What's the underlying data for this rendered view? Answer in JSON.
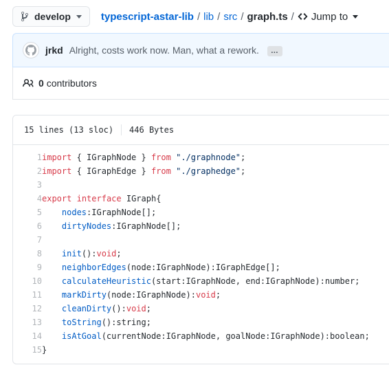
{
  "topbar": {
    "branch": {
      "label": "develop",
      "icon": "git-branch-icon"
    },
    "breadcrumb": {
      "repo": "typescript-astar-lib",
      "separator": "/",
      "segments": [
        "lib",
        "src"
      ],
      "file": "graph.ts"
    },
    "jump_to": {
      "label": "Jump to",
      "icon": "code-icon"
    }
  },
  "commit": {
    "author": "jrkd",
    "message": "Alright, costs work now. Man, what a rework.",
    "expand_label": "…",
    "avatar_icon": "github-mark-avatar",
    "background": "#f1f8ff",
    "border": "#c8e1ff"
  },
  "contributors": {
    "icon": "people-icon",
    "count": "0",
    "label": "contributors"
  },
  "file": {
    "lines_text": "15 lines (13 sloc)",
    "size_text": "446 Bytes",
    "code": [
      {
        "n": "1",
        "tokens": [
          {
            "t": "import",
            "c": "k"
          },
          {
            "t": " { IGraphNode } ",
            "c": "p"
          },
          {
            "t": "from",
            "c": "k"
          },
          {
            "t": " ",
            "c": "p"
          },
          {
            "t": "\"./graphnode\"",
            "c": "s"
          },
          {
            "t": ";",
            "c": "p"
          }
        ]
      },
      {
        "n": "2",
        "tokens": [
          {
            "t": "import",
            "c": "k"
          },
          {
            "t": " { IGraphEdge } ",
            "c": "p"
          },
          {
            "t": "from",
            "c": "k"
          },
          {
            "t": " ",
            "c": "p"
          },
          {
            "t": "\"./graphedge\"",
            "c": "s"
          },
          {
            "t": ";",
            "c": "p"
          }
        ]
      },
      {
        "n": "3",
        "tokens": []
      },
      {
        "n": "4",
        "tokens": [
          {
            "t": "export",
            "c": "k"
          },
          {
            "t": " ",
            "c": "p"
          },
          {
            "t": "interface",
            "c": "k"
          },
          {
            "t": " IGraph{",
            "c": "p"
          }
        ]
      },
      {
        "n": "5",
        "tokens": [
          {
            "t": "    ",
            "c": "p"
          },
          {
            "t": "nodes",
            "c": "f"
          },
          {
            "t": ":IGraphNode[];",
            "c": "p"
          }
        ]
      },
      {
        "n": "6",
        "tokens": [
          {
            "t": "    ",
            "c": "p"
          },
          {
            "t": "dirtyNodes",
            "c": "f"
          },
          {
            "t": ":IGraphNode[];",
            "c": "p"
          }
        ]
      },
      {
        "n": "7",
        "tokens": []
      },
      {
        "n": "8",
        "tokens": [
          {
            "t": "    ",
            "c": "p"
          },
          {
            "t": "init",
            "c": "f"
          },
          {
            "t": "():",
            "c": "p"
          },
          {
            "t": "void",
            "c": "k"
          },
          {
            "t": ";",
            "c": "p"
          }
        ]
      },
      {
        "n": "9",
        "tokens": [
          {
            "t": "    ",
            "c": "p"
          },
          {
            "t": "neighborEdges",
            "c": "f"
          },
          {
            "t": "(node:IGraphNode):IGraphEdge[];",
            "c": "p"
          }
        ]
      },
      {
        "n": "10",
        "tokens": [
          {
            "t": "    ",
            "c": "p"
          },
          {
            "t": "calculateHeuristic",
            "c": "f"
          },
          {
            "t": "(start:IGraphNode, end:IGraphNode):number;",
            "c": "p"
          }
        ]
      },
      {
        "n": "11",
        "tokens": [
          {
            "t": "    ",
            "c": "p"
          },
          {
            "t": "markDirty",
            "c": "f"
          },
          {
            "t": "(node:IGraphNode):",
            "c": "p"
          },
          {
            "t": "void",
            "c": "k"
          },
          {
            "t": ";",
            "c": "p"
          }
        ]
      },
      {
        "n": "12",
        "tokens": [
          {
            "t": "    ",
            "c": "p"
          },
          {
            "t": "cleanDirty",
            "c": "f"
          },
          {
            "t": "():",
            "c": "p"
          },
          {
            "t": "void",
            "c": "k"
          },
          {
            "t": ";",
            "c": "p"
          }
        ]
      },
      {
        "n": "13",
        "tokens": [
          {
            "t": "    ",
            "c": "p"
          },
          {
            "t": "toString",
            "c": "f"
          },
          {
            "t": "():string;",
            "c": "p"
          }
        ]
      },
      {
        "n": "14",
        "tokens": [
          {
            "t": "    ",
            "c": "p"
          },
          {
            "t": "isAtGoal",
            "c": "f"
          },
          {
            "t": "(currentNode:IGraphNode, goalNode:IGraphNode):boolean;",
            "c": "p"
          }
        ]
      },
      {
        "n": "15",
        "tokens": [
          {
            "t": "}",
            "c": "p"
          }
        ]
      }
    ]
  },
  "colors": {
    "link": "#0366d6",
    "keyword": "#d73a49",
    "string": "#032f62",
    "function": "#005cc5",
    "text": "#24292e",
    "muted": "#586069"
  }
}
